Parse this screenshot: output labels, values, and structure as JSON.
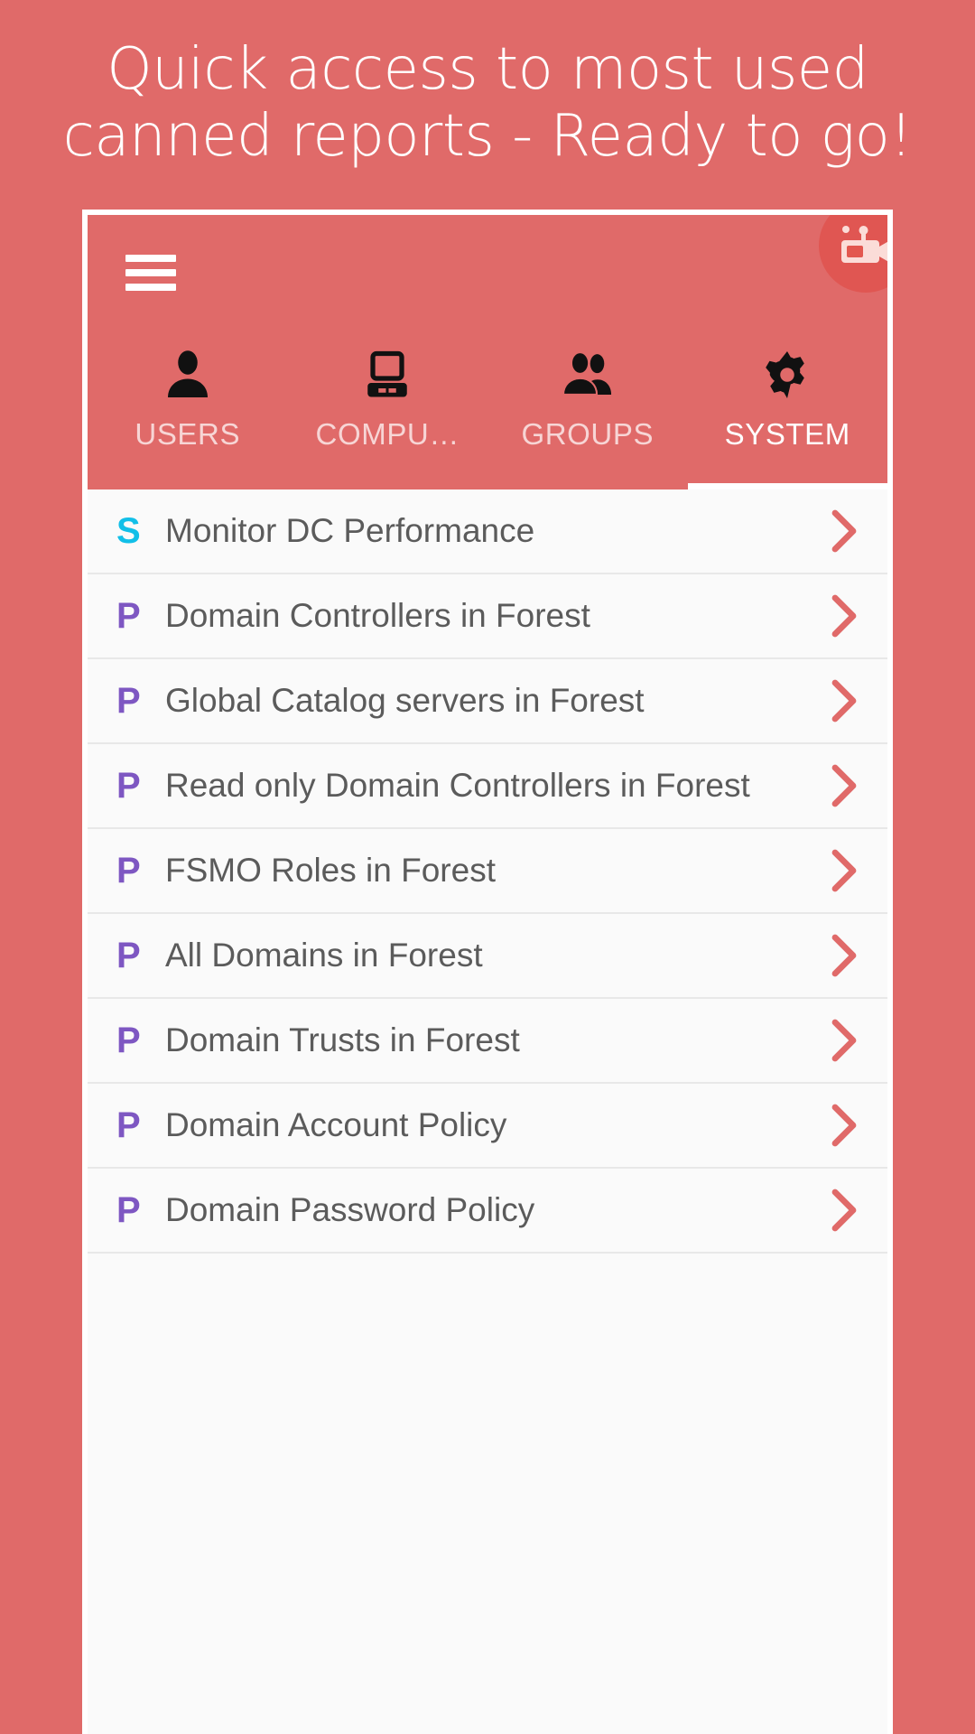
{
  "promo": {
    "line1": "Quick access to most used",
    "line2": "canned reports - Ready to go!"
  },
  "colors": {
    "brand": "#e06a69",
    "accent_purple": "#7e57c2",
    "accent_cyan": "#12bfe8",
    "chevron": "#e06a69",
    "list_bg": "#fafafa",
    "text": "#5b5b5b"
  },
  "appbar": {
    "menu_icon": "hamburger-menu-icon",
    "record_icon": "video-camera-icon"
  },
  "tabs": [
    {
      "label": "USERS",
      "icon": "person-icon",
      "active": false
    },
    {
      "label": "COMPU…",
      "icon": "computer-icon",
      "active": false
    },
    {
      "label": "GROUPS",
      "icon": "people-icon",
      "active": false
    },
    {
      "label": "SYSTEM",
      "icon": "gear-icon",
      "active": true
    }
  ],
  "list": {
    "items": [
      {
        "badge": "S",
        "badge_type": "s",
        "label": "Monitor DC Performance",
        "chevron": "chevron-right-icon"
      },
      {
        "badge": "P",
        "badge_type": "p",
        "label": "Domain Controllers in Forest",
        "chevron": "chevron-right-icon"
      },
      {
        "badge": "P",
        "badge_type": "p",
        "label": "Global Catalog servers in Forest",
        "chevron": "chevron-right-icon"
      },
      {
        "badge": "P",
        "badge_type": "p",
        "label": "Read only Domain Controllers in Forest",
        "chevron": "chevron-right-icon"
      },
      {
        "badge": "P",
        "badge_type": "p",
        "label": "FSMO Roles in Forest",
        "chevron": "chevron-right-icon"
      },
      {
        "badge": "P",
        "badge_type": "p",
        "label": "All Domains in Forest",
        "chevron": "chevron-right-icon"
      },
      {
        "badge": "P",
        "badge_type": "p",
        "label": "Domain Trusts in Forest",
        "chevron": "chevron-right-icon"
      },
      {
        "badge": "P",
        "badge_type": "p",
        "label": "Domain Account Policy",
        "chevron": "chevron-right-icon"
      },
      {
        "badge": "P",
        "badge_type": "p",
        "label": "Domain Password Policy",
        "chevron": "chevron-right-icon"
      }
    ]
  }
}
